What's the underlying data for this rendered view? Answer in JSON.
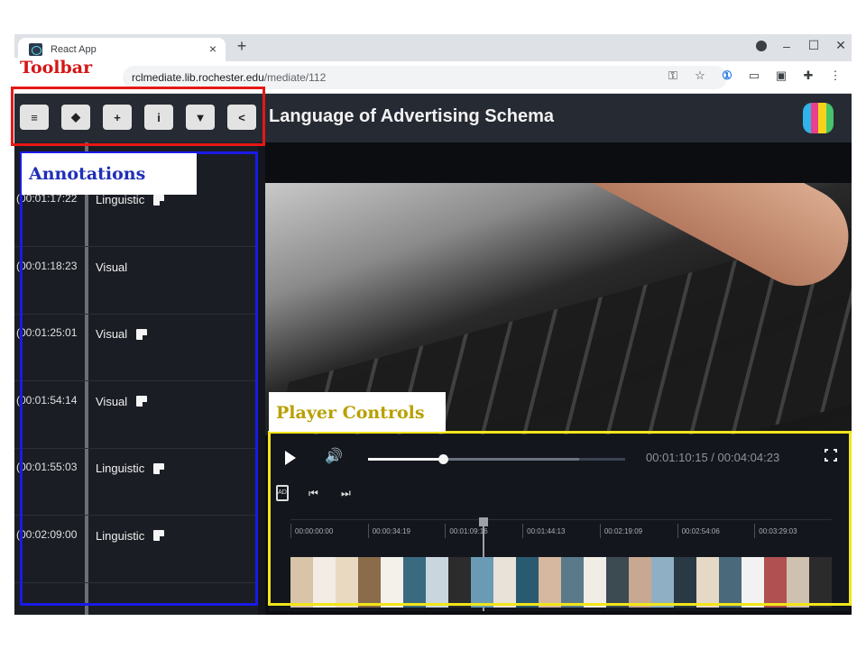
{
  "browser": {
    "tab_title": "React App",
    "tab_close": "×",
    "new_tab": "+",
    "url_host": "rclmediate.lib.rochester.edu",
    "url_path": "/mediate/112",
    "window_controls": [
      "–",
      "☐",
      "✕"
    ],
    "address_icons": [
      "key-icon",
      "star-icon",
      "1password-icon",
      "document-icon",
      "square-icon",
      "puzzle-icon",
      "kebab-menu-icon"
    ]
  },
  "app": {
    "title": "Language of Advertising Schema",
    "toolbar_buttons": [
      "database-icon",
      "tags-icon",
      "plus-icon",
      "info-icon",
      "filter-icon",
      "share-icon"
    ]
  },
  "annotations": [
    {
      "time": "(00:01:17:22",
      "label": "Linguistic",
      "has_note": true
    },
    {
      "time": "(00:01:18:23",
      "label": "Visual",
      "has_note": false
    },
    {
      "time": "(00:01:25:01",
      "label": "Visual",
      "has_note": true
    },
    {
      "time": "(00:01:54:14",
      "label": "Visual",
      "has_note": true
    },
    {
      "time": "(00:01:55:03",
      "label": "Linguistic",
      "has_note": true
    },
    {
      "time": "(00:02:09:00",
      "label": "Linguistic",
      "has_note": true
    }
  ],
  "player": {
    "timecode": "00:01:10:15 / 00:04:04:23",
    "progress_fraction": 0.29,
    "buffered_fraction": 0.82,
    "timeline_ticks": [
      "00:00:00:00",
      "00:00:34:19",
      "00:01:09:16",
      "00:01:44:13",
      "00:02:19:09",
      "00:02:54:06",
      "00:03:29:03"
    ],
    "playhead_fraction": 0.355
  },
  "overlay_labels": {
    "toolbar": "Toolbar",
    "annotations": "Annotations",
    "player_controls": "Player Controls"
  },
  "colors": {
    "toolbar_outline": "#e61717",
    "annotations_outline": "#1a1ae6",
    "player_outline": "#f2e51a",
    "logo_stripes": [
      "#2fb3e8",
      "#e8408c",
      "#f5d31a",
      "#46c46a"
    ],
    "strip_frames": [
      "#d8c4a8",
      "#f2ece4",
      "#e8d9c0",
      "#8a6b4a",
      "#f4f0ea",
      "#3a6a80",
      "#c9d6de",
      "#2c2c2c",
      "#6a9bb5",
      "#e8e2d8",
      "#2a5a70",
      "#d6b8a0",
      "#5a7a8a",
      "#f0ece6",
      "#3c4a52",
      "#c8a890",
      "#8fb0c4",
      "#2a3a44",
      "#e6d8c6",
      "#4a6a7c",
      "#f2f2f2",
      "#b05050",
      "#d0c0b0",
      "#2b2b2b"
    ]
  }
}
